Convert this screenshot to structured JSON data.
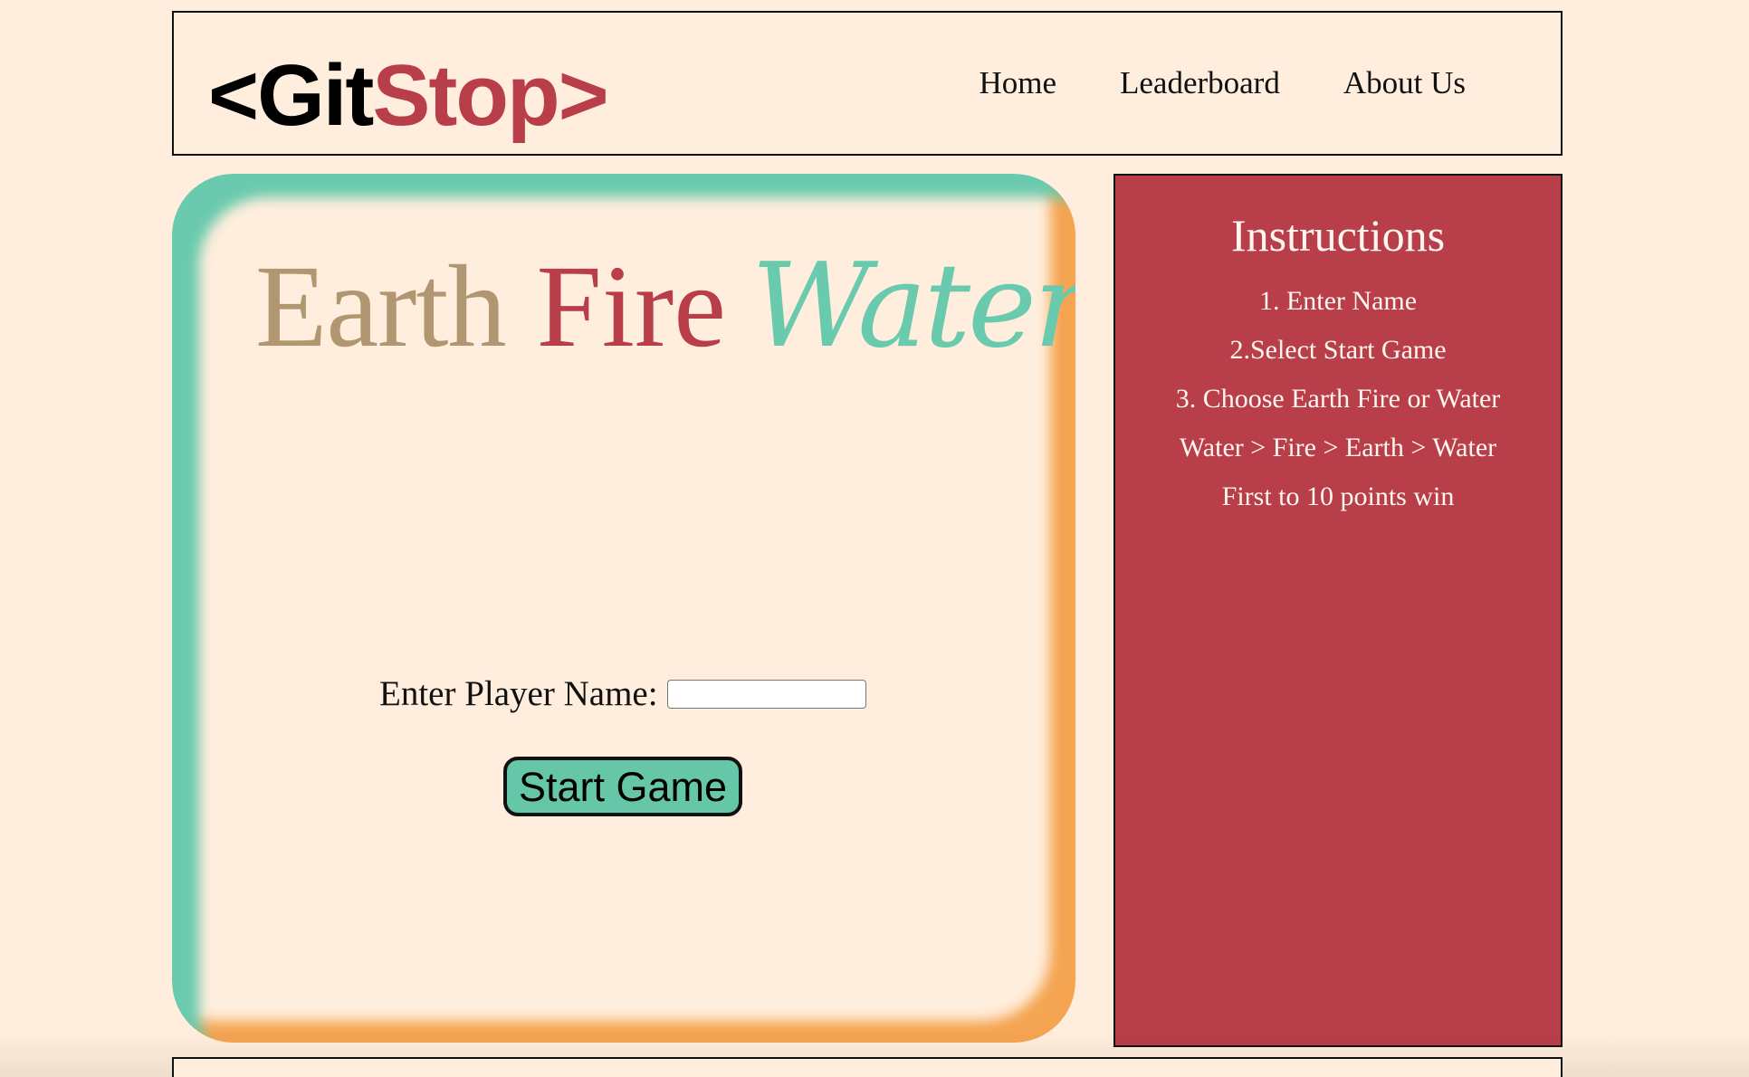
{
  "header": {
    "logo": {
      "prefix": "<",
      "git": "Git",
      "stop": "Stop",
      "suffix": ">"
    },
    "nav": [
      {
        "label": "Home"
      },
      {
        "label": "Leaderboard"
      },
      {
        "label": "About Us"
      }
    ]
  },
  "game": {
    "title": {
      "earth": "Earth",
      "fire": "Fire",
      "water": "Water"
    },
    "player_name_label": "Enter Player Name:",
    "player_name_value": "",
    "start_button": "Start Game"
  },
  "instructions": {
    "title": "Instructions",
    "items": [
      "1. Enter Name",
      "2.Select Start Game",
      "3. Choose Earth Fire or Water",
      "Water > Fire > Earth > Water",
      "First to 10 points win"
    ]
  },
  "colors": {
    "background": "#ffeedd",
    "brand_red": "#b83e49",
    "earth": "#b19672",
    "water_green": "#6acaad",
    "fire_orange": "#f5a451",
    "button_green": "#65c6a8"
  }
}
